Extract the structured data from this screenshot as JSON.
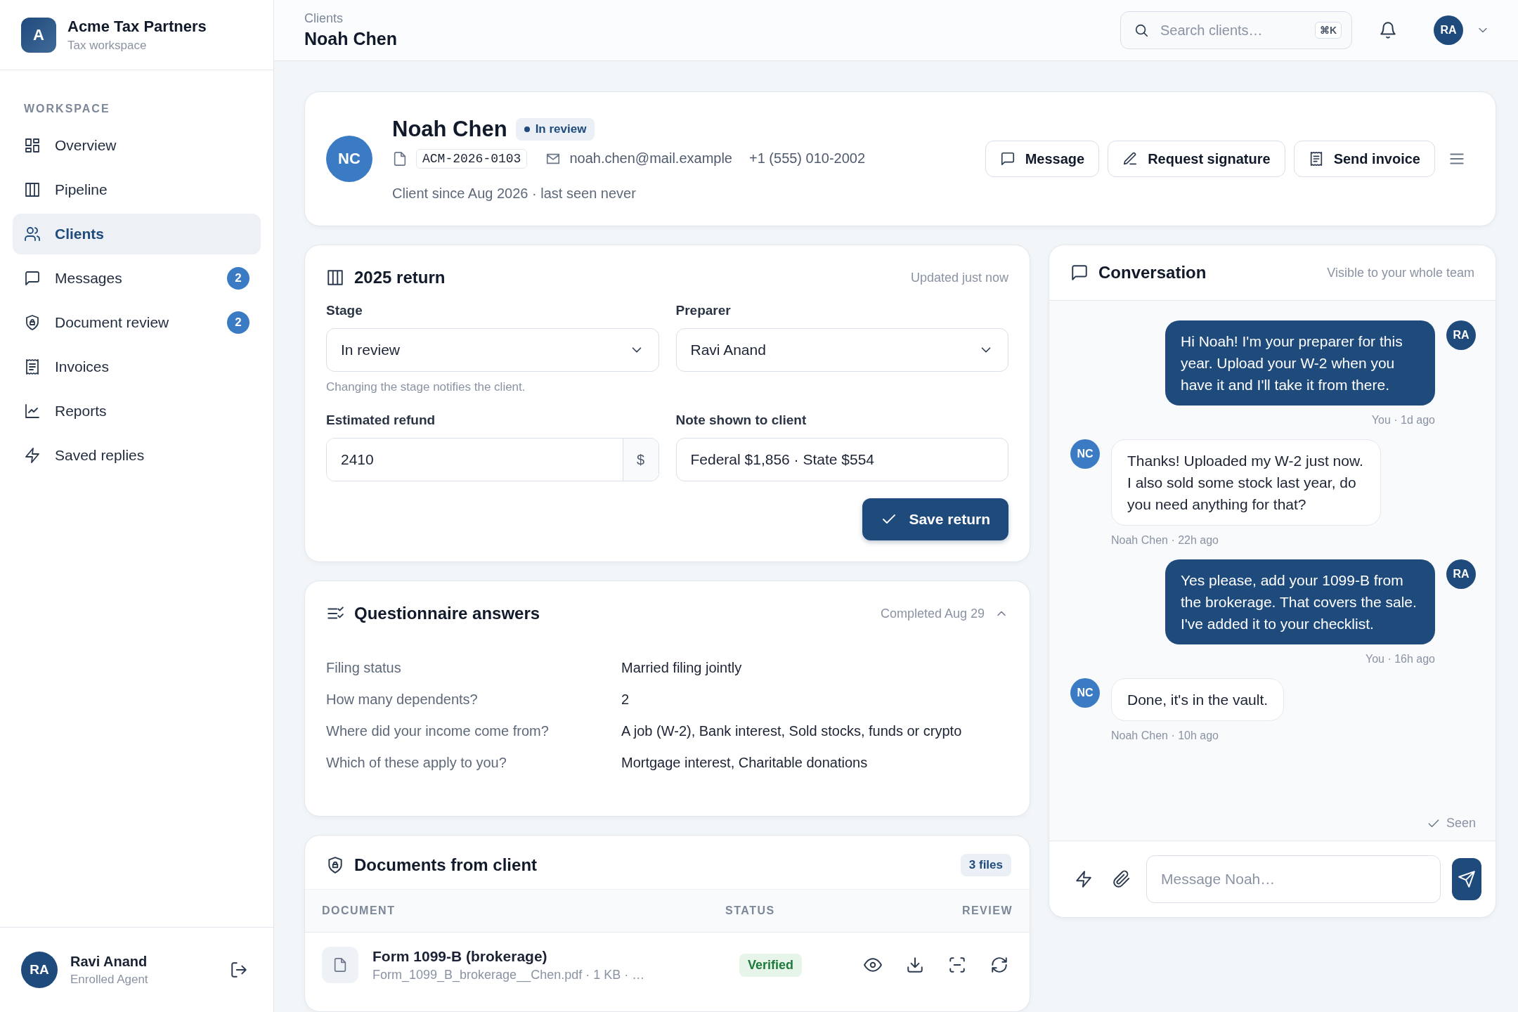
{
  "brand": {
    "logo": "A",
    "name": "Acme Tax Partners",
    "subtitle": "Tax workspace"
  },
  "sidebar": {
    "section": "WORKSPACE",
    "items": [
      {
        "label": "Overview",
        "selected": false
      },
      {
        "label": "Pipeline",
        "selected": false
      },
      {
        "label": "Clients",
        "selected": true
      },
      {
        "label": "Messages",
        "selected": false,
        "badge": "2"
      },
      {
        "label": "Document review",
        "selected": false,
        "badge": "2"
      },
      {
        "label": "Invoices",
        "selected": false
      },
      {
        "label": "Reports",
        "selected": false
      },
      {
        "label": "Saved replies",
        "selected": false
      }
    ]
  },
  "user": {
    "initials": "RA",
    "name": "Ravi Anand",
    "role": "Enrolled Agent"
  },
  "header": {
    "breadcrumb": "Clients",
    "title": "Noah Chen",
    "search": {
      "placeholder": "Search clients…",
      "shortcut": "⌘K"
    },
    "avatar": "RA"
  },
  "client": {
    "initials": "NC",
    "name": "Noah Chen",
    "status": "In review",
    "id": "ACM-2026-0103",
    "email": "noah.chen@mail.example",
    "phone": "+1 (555) 010-2002",
    "since": "Client since Aug 2026 · last seen never",
    "actions": [
      "Message",
      "Request signature",
      "Send invoice"
    ]
  },
  "return": {
    "title": "2025 return",
    "updated": "Updated just now",
    "stage": {
      "label": "Stage",
      "value": "In review",
      "hint": "Changing the stage notifies the client."
    },
    "preparer": {
      "label": "Preparer",
      "value": "Ravi Anand"
    },
    "refund": {
      "label": "Estimated refund",
      "value": "2410",
      "unit": "$"
    },
    "note": {
      "label": "Note shown to client",
      "value": "Federal $1,856 · State $554"
    },
    "save": "Save return"
  },
  "questionnaire": {
    "title": "Questionnaire answers",
    "status": "Completed Aug 29",
    "expanded": true,
    "rows": [
      {
        "question": "Filing status",
        "answer": "Married filing jointly"
      },
      {
        "question": "How many dependents?",
        "answer": "2"
      },
      {
        "question": "Where did your income come from?",
        "answer": "A job (W-2), Bank interest, Sold stocks, funds or crypto"
      },
      {
        "question": "Which of these apply to you?",
        "answer": "Mortgage interest, Charitable donations"
      }
    ]
  },
  "documents": {
    "title": "Documents from client",
    "count": "3 files",
    "columns": [
      "DOCUMENT",
      "STATUS",
      "REVIEW"
    ],
    "rows": [
      {
        "name": "Form 1099-B (brokerage)",
        "file": "Form_1099_B_brokerage__Chen.pdf · 1 KB · …",
        "status": "Verified"
      }
    ]
  },
  "conversation": {
    "title": "Conversation",
    "visibility": "Visible to your whole team",
    "messages": [
      {
        "kind": "sent",
        "initials": "RA",
        "text": "Hi Noah! I'm your preparer for this year. Upload your W-2 when you have it and I'll take it from there.",
        "meta": "You · 1d ago"
      },
      {
        "kind": "received",
        "initials": "NC",
        "text": "Thanks! Uploaded my W-2 just now. I also sold some stock last year, do you need anything for that?",
        "meta": "Noah Chen · 22h ago"
      },
      {
        "kind": "sent",
        "initials": "RA",
        "text": "Yes please, add your 1099-B from the brokerage. That covers the sale. I've added it to your checklist.",
        "meta": "You · 16h ago"
      },
      {
        "kind": "received",
        "initials": "NC",
        "text": "Done, it's in the vault.",
        "meta": "Noah Chen · 10h ago"
      }
    ],
    "seen": "Seen",
    "placeholder": "Message Noah…"
  }
}
